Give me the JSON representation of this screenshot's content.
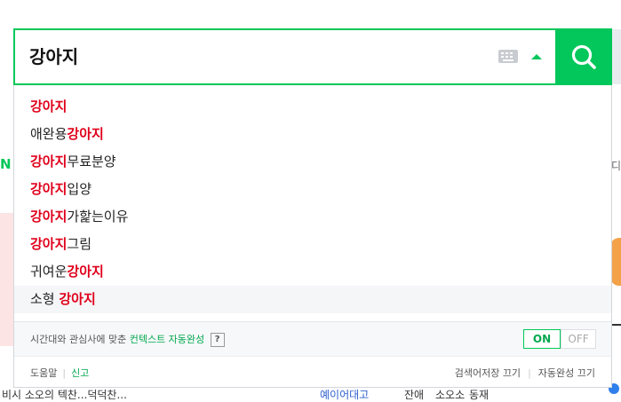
{
  "search": {
    "query": "강아지"
  },
  "suggestions": [
    {
      "pre": "",
      "hl": "강아지",
      "post": ""
    },
    {
      "pre": "애완용",
      "hl": "강아지",
      "post": ""
    },
    {
      "pre": "",
      "hl": "강아지",
      "post": "무료분양"
    },
    {
      "pre": "",
      "hl": "강아지",
      "post": "입양"
    },
    {
      "pre": "",
      "hl": "강아지",
      "post": "가핥는이유"
    },
    {
      "pre": "",
      "hl": "강아지",
      "post": "그림"
    },
    {
      "pre": "귀여운",
      "hl": "강아지",
      "post": ""
    },
    {
      "pre": "소형 ",
      "hl": "강아지",
      "post": ""
    }
  ],
  "notice": {
    "text_before": "시간대와 관심사에 맞춘 ",
    "link": "컨텍스트 자동완성",
    "help": "?"
  },
  "toggle": {
    "on_label": "ON",
    "off_label": "OFF"
  },
  "footer": {
    "help_label": "도움말",
    "report_label": "신고",
    "history_off_label": "검색어저장 끄기",
    "autocomplete_off_label": "자동완성 끄기"
  },
  "background": {
    "left_letter": "N",
    "right_letter": "디",
    "bottom_texts": [
      "비시 소오의 텍찬...덕덕찬...",
      "예이어대고",
      "잔애",
      "소오소",
      "동재"
    ]
  },
  "colors": {
    "brand_green": "#03c75a",
    "highlight_red": "#e0001b"
  },
  "icons": {
    "search_button": "magnifier-icon",
    "keyboard": "keyboard-icon",
    "collapse": "caret-up-icon"
  }
}
